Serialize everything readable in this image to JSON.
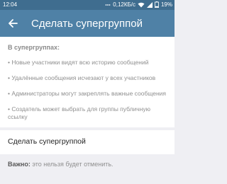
{
  "status_bar": {
    "time": "12:04",
    "network_speed": "0,12КБ/с",
    "battery": "19%",
    "icons": [
      "dots-icon",
      "wifi-icon",
      "signal-icon",
      "battery-icon"
    ]
  },
  "toolbar": {
    "title": "Сделать супергруппой",
    "back_icon": "arrow-left-icon"
  },
  "info": {
    "heading": "В супергруппах:",
    "items": [
      "• Новые участники видят всю историю сообщений",
      "• Удалённые сообщения исчезают у всех участников",
      "• Администраторы могут закреплять важные сообщения",
      "• Создатель может выбрать для группы публичную ссылку"
    ]
  },
  "action": {
    "label": "Сделать супергруппой"
  },
  "warning": {
    "bold": "Важно:",
    "text": " это нельзя будет отменить."
  },
  "colors": {
    "status_bar": "#3f6d8f",
    "toolbar": "#4f81a6",
    "background": "#efeff3",
    "card": "#ffffff"
  }
}
